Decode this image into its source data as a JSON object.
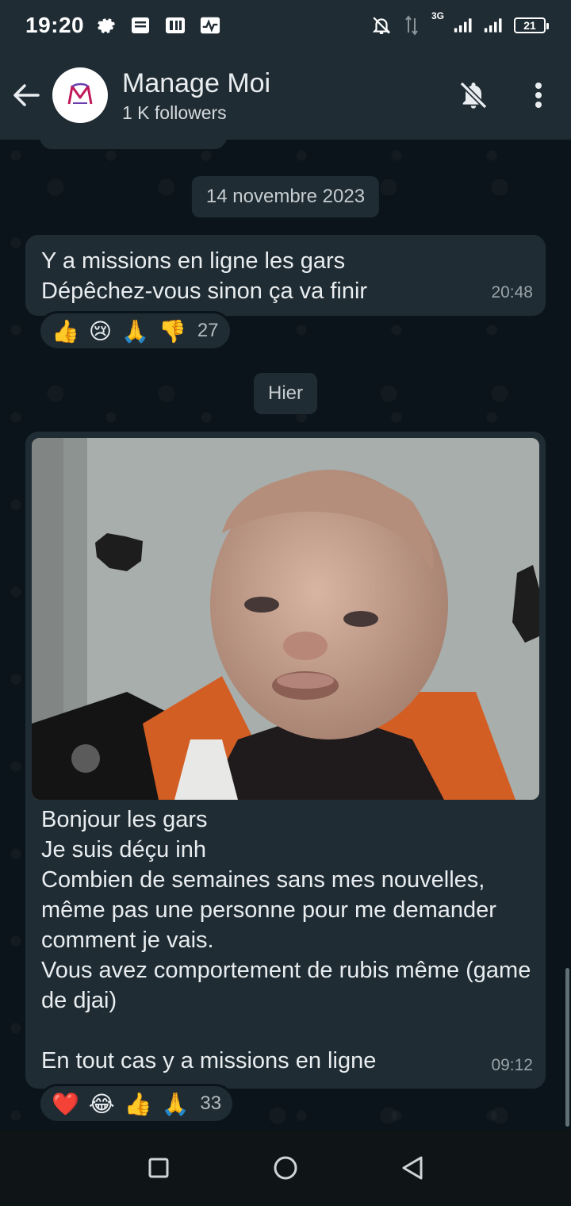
{
  "status_bar": {
    "time": "19:20",
    "network": "3G",
    "battery": "21"
  },
  "header": {
    "title": "Manage Moi",
    "subtitle": "1 K followers"
  },
  "chat": {
    "date_chip_1": "14 novembre 2023",
    "message_1": {
      "text": "Y a missions en ligne les gars\nDépêchez-vous sinon ça va finir",
      "time": "20:48",
      "reactions": [
        "👍",
        "😢",
        "🙏",
        "👎"
      ],
      "reaction_count": "27"
    },
    "date_chip_2": "Hier",
    "message_2": {
      "text": "Bonjour les gars\nJe suis déçu inh\nCombien de semaines sans mes nouvelles, même pas une personne pour me demander comment je vais.\nVous avez comportement de rubis même (game de djai)\n\nEn tout cas y a missions en ligne",
      "time": "09:12",
      "reactions": [
        "❤️",
        "😂",
        "👍",
        "🙏"
      ],
      "reaction_count": "33"
    }
  },
  "colors": {
    "header_bg": "#1f2c34",
    "chat_bg": "#0b141a",
    "bubble_bg": "#1f2c34"
  }
}
